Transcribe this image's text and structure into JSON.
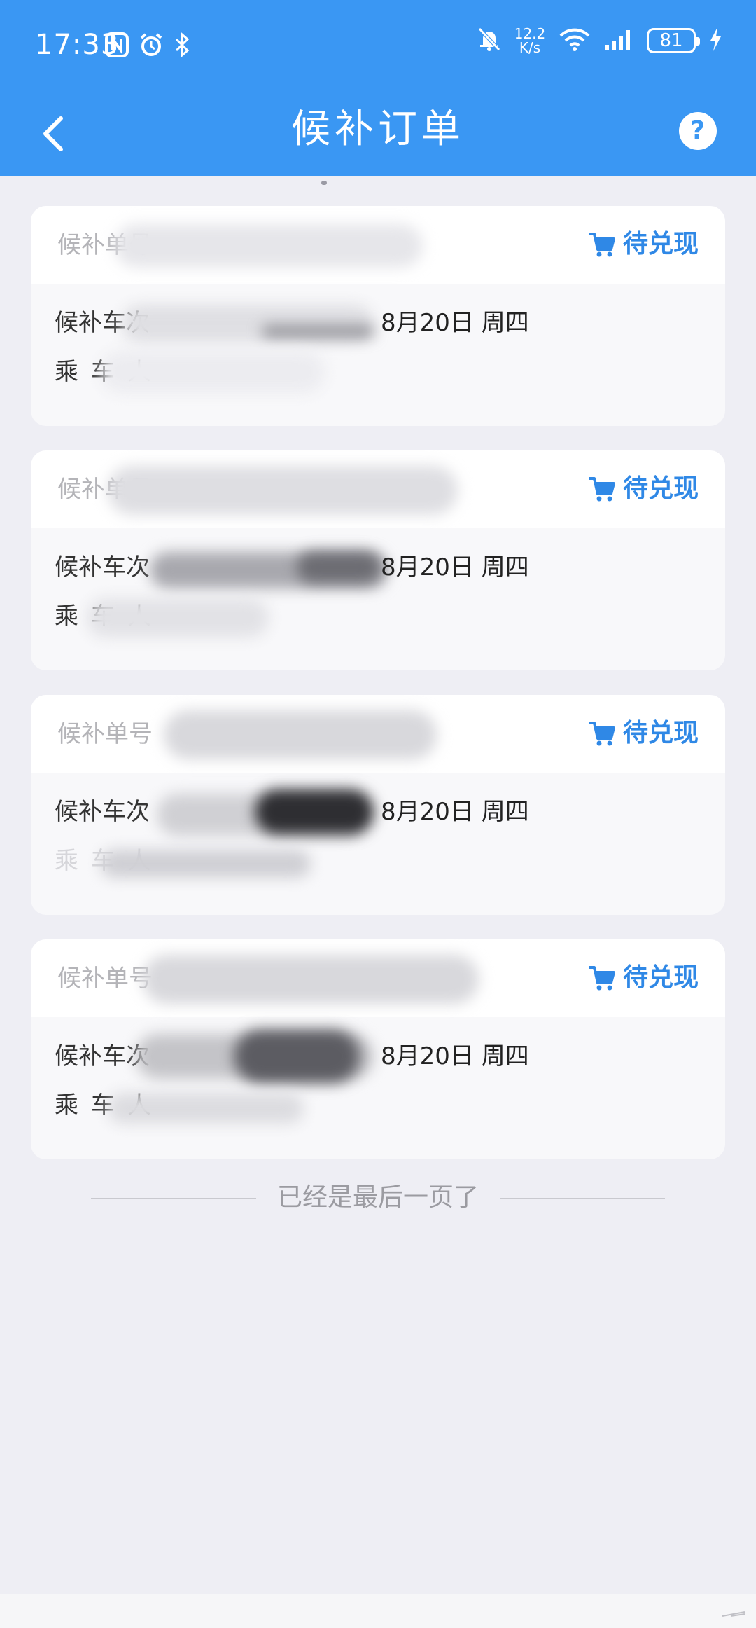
{
  "status_bar": {
    "time": "17:33",
    "net_speed_value": "12.2",
    "net_speed_unit": "K/s",
    "battery": "81"
  },
  "header": {
    "title": "候补订单",
    "help_icon": "?"
  },
  "cards": [
    {
      "order_label": "候补单号",
      "status": "待兑现",
      "train_label": "候补车次",
      "date": "8月20日 周四",
      "passenger_label": "乘车人"
    },
    {
      "order_label": "候补单号",
      "status": "待兑现",
      "train_label": "候补车次",
      "date": "8月20日 周四",
      "passenger_label": "乘车人"
    },
    {
      "order_label": "候补单号",
      "status": "待兑现",
      "train_label": "候补车次",
      "date": "8月20日 周四",
      "passenger_label": "乘车人"
    },
    {
      "order_label": "候补单号",
      "status": "待兑现",
      "train_label": "候补车次",
      "date": "8月20日 周四",
      "passenger_label": "乘车人"
    }
  ],
  "footer": {
    "end_text": "已经是最后一页了"
  },
  "colors": {
    "header_bg": "#3a97f3",
    "accent": "#2f88e6",
    "page_bg": "#eeeef4"
  }
}
